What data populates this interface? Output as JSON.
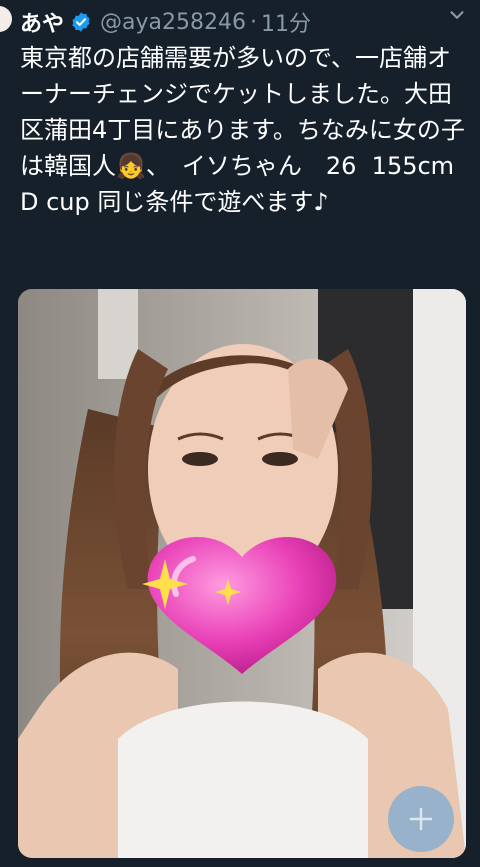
{
  "tweet": {
    "author_name": "あや",
    "handle": "@aya258246",
    "separator": "·",
    "time": "11分",
    "text": "東京都の店舗需要が多いので、一店舗オーナーチェンジでケットしました。大田区蒲田4丁目にあります。ちなみに女の子は韓国人👧、　イソちゃん　26  155cm D cup 同じ条件で遊べます♪"
  },
  "icons": {
    "verified": "verified-badge-icon",
    "more": "more-options-icon",
    "media": "photo-with-heart-sticker",
    "add": "plus-icon"
  },
  "colors": {
    "background": "#15202b",
    "text_primary": "#ffffff",
    "text_secondary": "#8899a6",
    "verified_blue": "#1d9bf0"
  }
}
